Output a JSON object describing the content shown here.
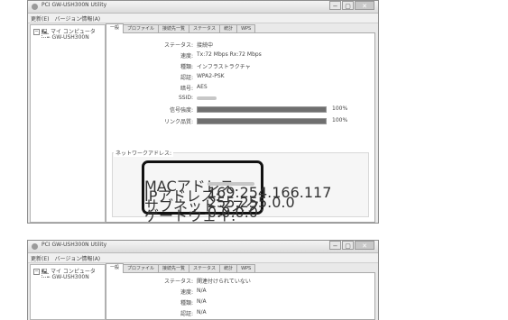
{
  "windows": [
    {
      "title": "PCI GW-USH300N Utility",
      "window_controls": [
        "−",
        "▢",
        "✕"
      ],
      "menu": [
        "更新(E)",
        "バージョン情報(A)"
      ],
      "tree": {
        "root": "マイ コンピュータ",
        "child": "GW-USH300N"
      },
      "tabs": [
        "一般",
        "プロファイル",
        "接続先一覧",
        "ステータス",
        "統計",
        "WPS"
      ],
      "active_tab": "一般",
      "info": [
        {
          "label": "ステータス:",
          "value": "接続中"
        },
        {
          "label": "速度:",
          "value": "Tx:72 Mbps Rx:72 Mbps"
        },
        {
          "label": "種類:",
          "value": "インフラストラクチャ"
        },
        {
          "label": "認証:",
          "value": "WPA2-PSK"
        },
        {
          "label": "暗号:",
          "value": "AES"
        },
        {
          "label": "SSID:",
          "value": ""
        }
      ],
      "meters": [
        {
          "label": "信号強度:",
          "percent_text": "100%",
          "level": 100
        },
        {
          "label": "リンク品質:",
          "percent_text": "100%",
          "level": 100
        }
      ],
      "network_group_label": "ネットワークアドレス:",
      "network": [
        {
          "label": "MACアドレス:",
          "value": ""
        },
        {
          "label": "IPアドレス:",
          "value": "169.254.166.117"
        },
        {
          "label": "サブネットマスク:",
          "value": "255.255.0.0"
        },
        {
          "label": "ゲートウェイ:",
          "value": "0.0.0.0"
        }
      ]
    },
    {
      "title": "PCI GW-USH300N Utility",
      "window_controls": [
        "−",
        "▢",
        "✕"
      ],
      "menu": [
        "更新(E)",
        "バージョン情報(A)"
      ],
      "tree": {
        "root": "マイ コンピュータ",
        "child": "GW-USH300N"
      },
      "tabs": [
        "一般",
        "プロファイル",
        "接続先一覧",
        "ステータス",
        "統計",
        "WPS"
      ],
      "active_tab": "一般",
      "info": [
        {
          "label": "ステータス:",
          "value": "関連付けられていない"
        },
        {
          "label": "速度:",
          "value": "N/A"
        },
        {
          "label": "種類:",
          "value": "N/A"
        },
        {
          "label": "認証:",
          "value": "N/A"
        }
      ]
    }
  ]
}
